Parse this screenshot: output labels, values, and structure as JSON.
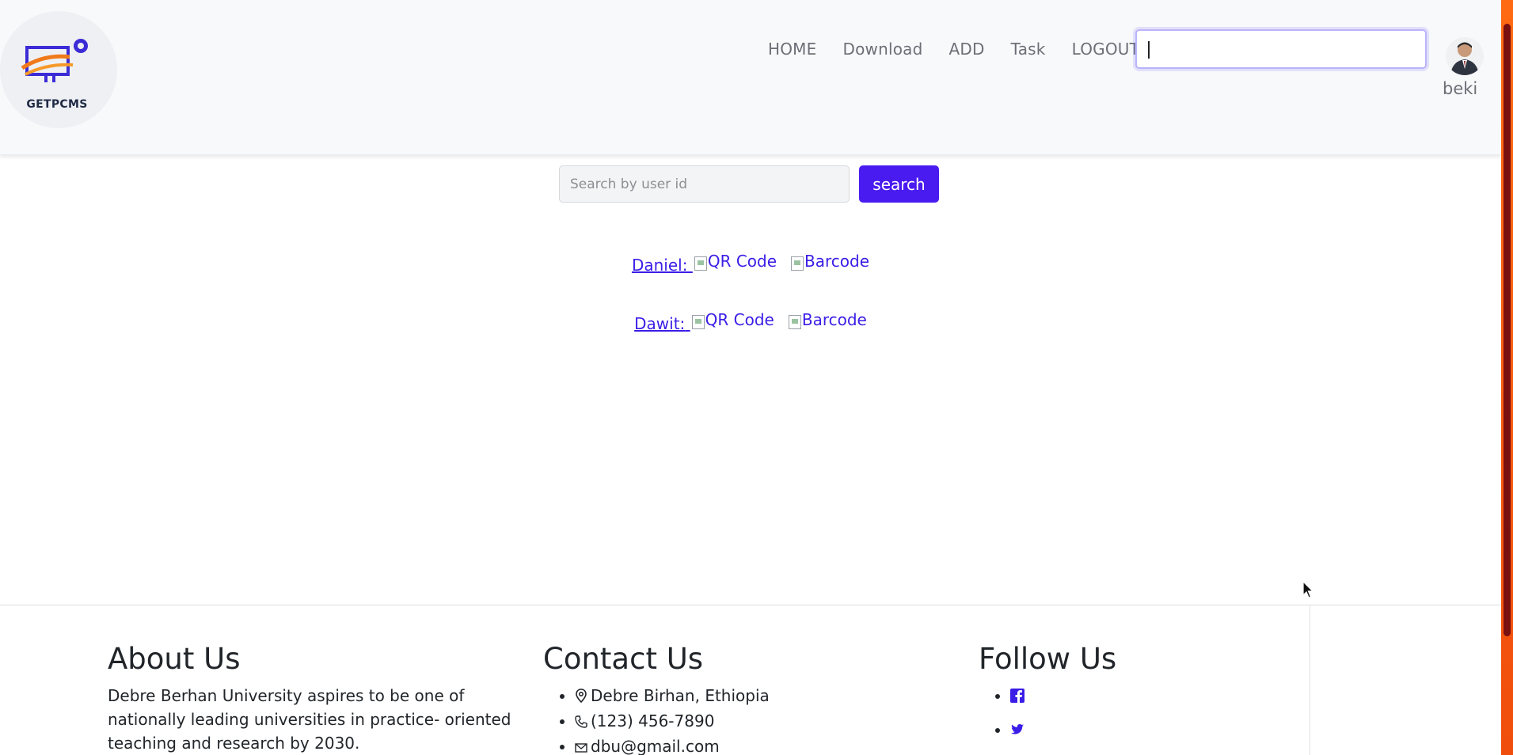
{
  "brand": {
    "logo_text": "GETPCMS"
  },
  "nav": {
    "items": [
      {
        "label": "HOME"
      },
      {
        "label": "Download"
      },
      {
        "label": "ADD"
      },
      {
        "label": "Task"
      },
      {
        "label": "LOGOUT"
      }
    ],
    "search_value": ""
  },
  "user": {
    "name": "beki"
  },
  "search": {
    "placeholder": "Search by user id",
    "button_label": "search"
  },
  "users": [
    {
      "name": "Daniel:",
      "qr_alt": "QR Code",
      "barcode_alt": "Barcode"
    },
    {
      "name": "Dawit:",
      "qr_alt": "QR Code",
      "barcode_alt": "Barcode"
    }
  ],
  "footer": {
    "about": {
      "title": "About Us",
      "text": "Debre Berhan University aspires to be one of nationally leading universities in practice- oriented teaching and research by 2030."
    },
    "contact": {
      "title": "Contact Us",
      "address": "Debre Birhan, Ethiopia",
      "phone": "(123) 456-7890",
      "email": "dbu@gmail.com"
    },
    "follow": {
      "title": "Follow Us",
      "links": [
        {
          "icon": "facebook-icon"
        },
        {
          "icon": "twitter-icon"
        }
      ]
    }
  },
  "colors": {
    "accent": "#4a1bf0",
    "link": "#3a1de6",
    "scrollbar": "#ff6a12"
  }
}
